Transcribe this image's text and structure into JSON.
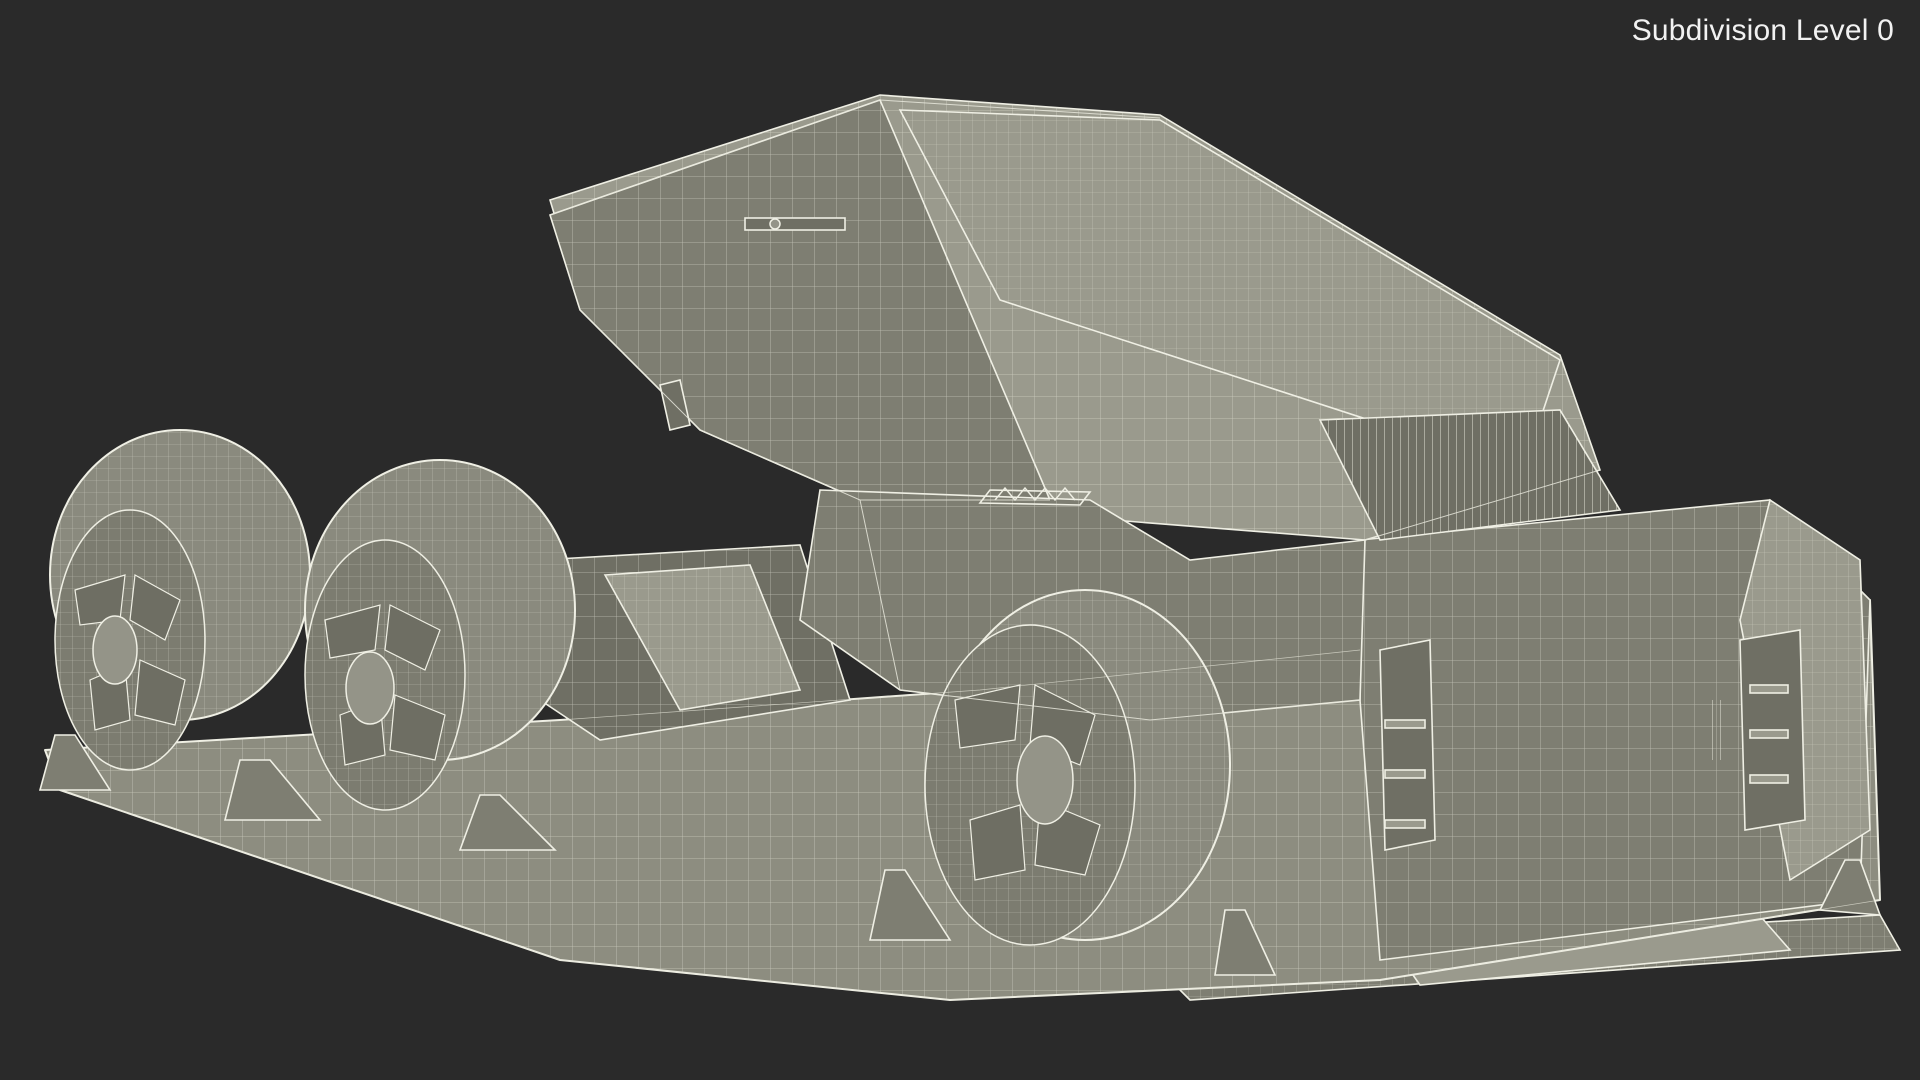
{
  "viewport": {
    "overlay_label": "Subdivision Level 0",
    "background_color": "#2a2a2a",
    "model_base_color": "#8d8d80",
    "wire_color": "#efefe4"
  }
}
